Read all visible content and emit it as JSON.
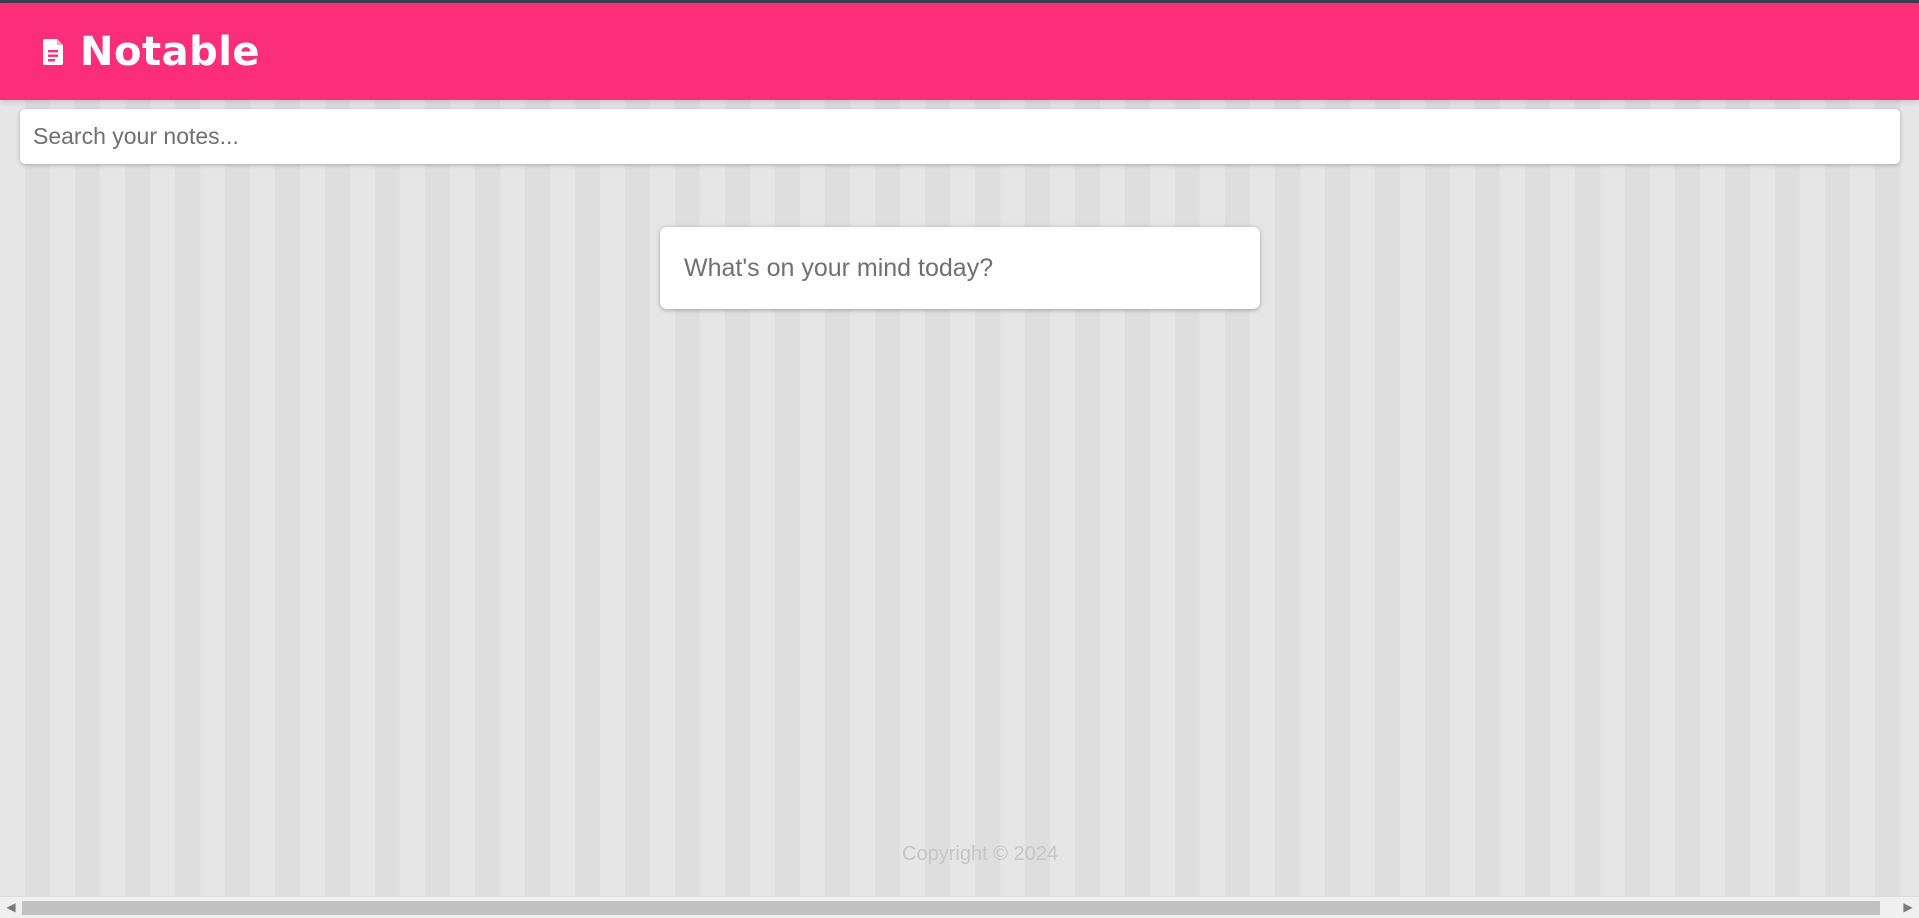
{
  "header": {
    "title": "Notable",
    "icon": "document-icon",
    "background_color": "#fc2e7a"
  },
  "search": {
    "value": "",
    "placeholder": "Search your notes..."
  },
  "note_composer": {
    "value": "",
    "placeholder": "What's on your mind today?"
  },
  "footer": {
    "copyright": "Copyright © 2024"
  },
  "scrollbar": {
    "left_arrow": "◀",
    "right_arrow": "▶"
  }
}
